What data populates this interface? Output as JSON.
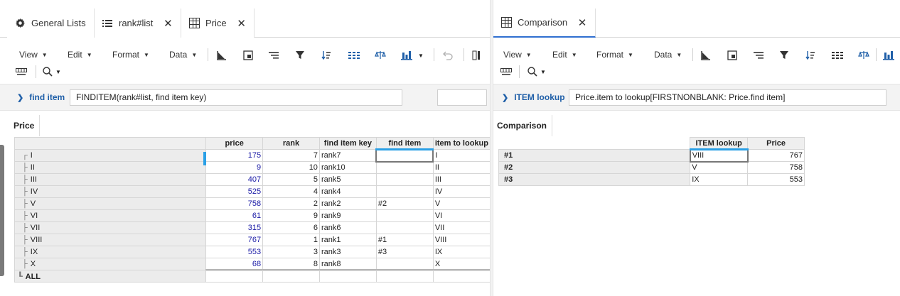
{
  "left_pane": {
    "tabs": [
      {
        "label": "General Lists",
        "icon": "gear-icon"
      },
      {
        "label": "rank#list",
        "icon": "list-icon",
        "closable": true
      },
      {
        "label": "Price",
        "icon": "table-icon",
        "closable": true,
        "active": true
      }
    ],
    "menus": [
      "View",
      "Edit",
      "Format",
      "Data"
    ],
    "formula": {
      "label": "find item",
      "expression": "FINDITEM(rank#list, find item key)"
    },
    "view_title": "Price",
    "columns": [
      "price",
      "rank",
      "find item key",
      "find item",
      "item to lookup"
    ],
    "rows": [
      {
        "item": "I",
        "price": "175",
        "rank": "7",
        "key": "rank7",
        "find": "",
        "lookup": "I"
      },
      {
        "item": "II",
        "price": "9",
        "rank": "10",
        "key": "rank10",
        "find": "",
        "lookup": "II"
      },
      {
        "item": "III",
        "price": "407",
        "rank": "5",
        "key": "rank5",
        "find": "",
        "lookup": "III"
      },
      {
        "item": "IV",
        "price": "525",
        "rank": "4",
        "key": "rank4",
        "find": "",
        "lookup": "IV"
      },
      {
        "item": "V",
        "price": "758",
        "rank": "2",
        "key": "rank2",
        "find": "#2",
        "lookup": "V"
      },
      {
        "item": "VI",
        "price": "61",
        "rank": "9",
        "key": "rank9",
        "find": "",
        "lookup": "VI"
      },
      {
        "item": "VII",
        "price": "315",
        "rank": "6",
        "key": "rank6",
        "find": "",
        "lookup": "VII"
      },
      {
        "item": "VIII",
        "price": "767",
        "rank": "1",
        "key": "rank1",
        "find": "#1",
        "lookup": "VIII"
      },
      {
        "item": "IX",
        "price": "553",
        "rank": "3",
        "key": "rank3",
        "find": "#3",
        "lookup": "IX"
      },
      {
        "item": "X",
        "price": "68",
        "rank": "8",
        "key": "rank8",
        "find": "",
        "lookup": "X"
      }
    ],
    "total_row_label": "ALL"
  },
  "right_pane": {
    "tabs": [
      {
        "label": "Comparison",
        "icon": "table-icon",
        "closable": true,
        "active": true
      }
    ],
    "menus": [
      "View",
      "Edit",
      "Format",
      "Data"
    ],
    "formula": {
      "label": "ITEM lookup",
      "expression": "Price.item to lookup[FIRSTNONBLANK: Price.find item]"
    },
    "view_title": "Comparison",
    "columns": [
      "ITEM lookup",
      "Price"
    ],
    "rows": [
      {
        "item": "#1",
        "lookup": "VIII",
        "price": "767"
      },
      {
        "item": "#2",
        "lookup": "V",
        "price": "758"
      },
      {
        "item": "#3",
        "lookup": "IX",
        "price": "553"
      }
    ]
  },
  "colors": {
    "accent": "#2f6fd0",
    "formula_label": "#1f5fa8",
    "value_blue": "#1a1aa6",
    "selection_bar": "#2aa0e6"
  }
}
